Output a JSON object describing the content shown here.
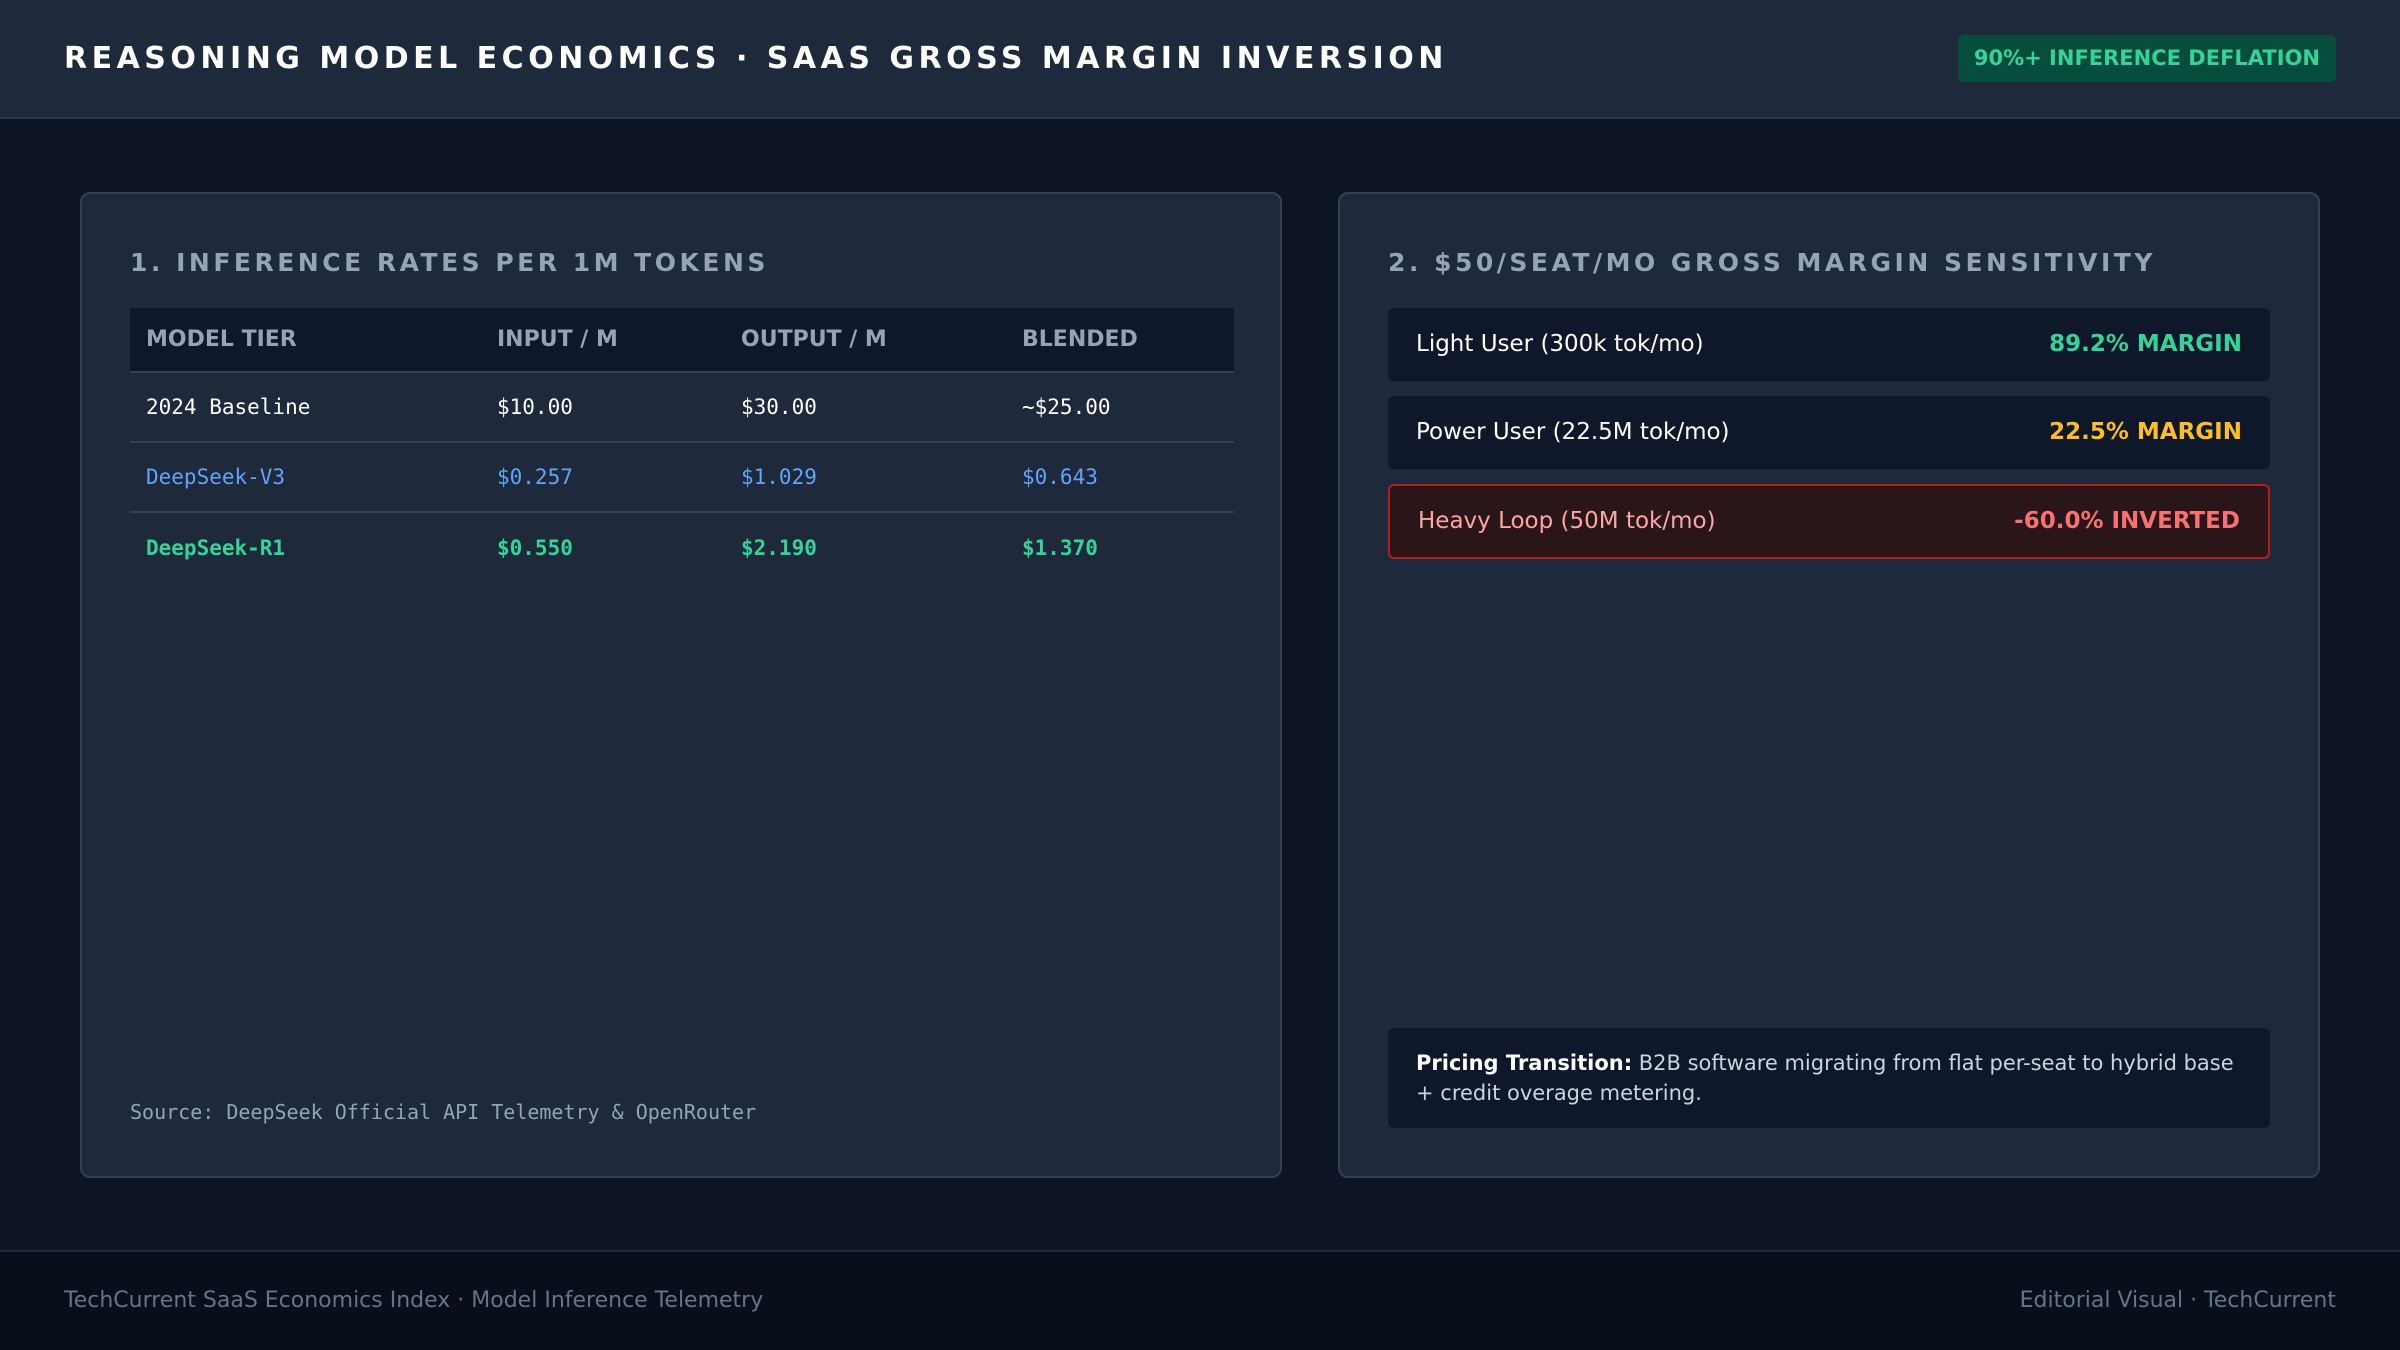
{
  "header": {
    "title": "REASONING MODEL ECONOMICS · SAAS GROSS MARGIN INVERSION",
    "badge": "90%+ INFERENCE DEFLATION"
  },
  "rates_panel": {
    "title": "1. INFERENCE RATES PER 1M TOKENS",
    "columns": [
      "MODEL TIER",
      "INPUT / M",
      "OUTPUT / M",
      "BLENDED"
    ],
    "rows": [
      {
        "model": "2024 Baseline",
        "input": "$10.00",
        "output": "$30.00",
        "blended": "~$25.00"
      },
      {
        "model": "DeepSeek-V3",
        "input": "$0.257",
        "output": "$1.029",
        "blended": "$0.643"
      },
      {
        "model": "DeepSeek-R1",
        "input": "$0.550",
        "output": "$2.190",
        "blended": "$1.370"
      }
    ],
    "source": "Source: DeepSeek Official API Telemetry & OpenRouter"
  },
  "margin_panel": {
    "title": "2. $50/SEAT/MO GROSS MARGIN SENSITIVITY",
    "tiers": [
      {
        "label": "Light User (300k tok/mo)",
        "value": "89.2% MARGIN"
      },
      {
        "label": "Power User (22.5M tok/mo)",
        "value": "22.5% MARGIN"
      },
      {
        "label": "Heavy Loop (50M tok/mo)",
        "value": "-60.0% INVERTED"
      }
    ],
    "note_label": "Pricing Transition:",
    "note_text": " B2B software migrating from flat per-seat to hybrid base + credit overage metering."
  },
  "footer": {
    "left": "TechCurrent SaaS Economics Index · Model Inference Telemetry",
    "right": "Editorial Visual · TechCurrent"
  },
  "colors": {
    "positive": "#34d399",
    "warning": "#fbbf24",
    "negative": "#f87171",
    "accent_blue": "#60a5fa"
  }
}
